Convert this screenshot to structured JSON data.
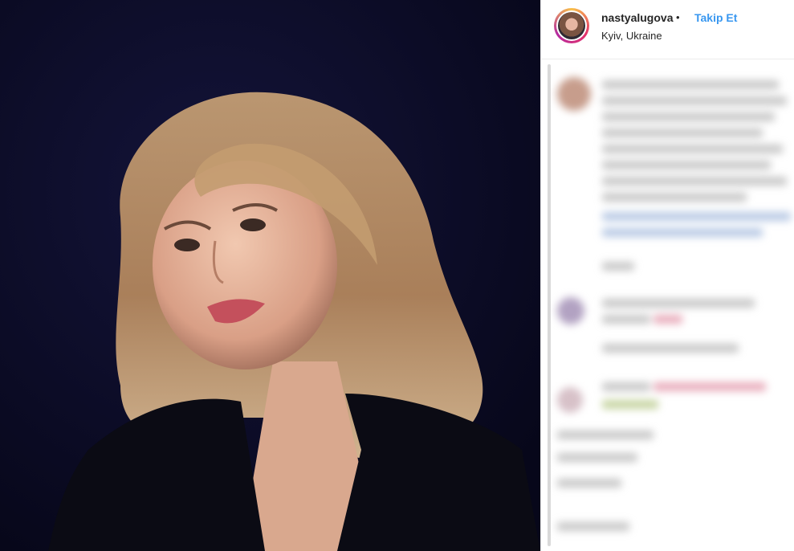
{
  "post": {
    "username": "nastyalugova",
    "separator": "•",
    "follow_label": "Takip Et",
    "location": "Kyiv, Ukraine"
  },
  "icons": {
    "avatar": "profile-avatar",
    "photo": "post-photo"
  },
  "colors": {
    "follow": "#3897f0",
    "photo_background": "#0c0c22",
    "avatar_ring_start": "#f9c14a",
    "avatar_ring_end": "#b42aa0"
  }
}
